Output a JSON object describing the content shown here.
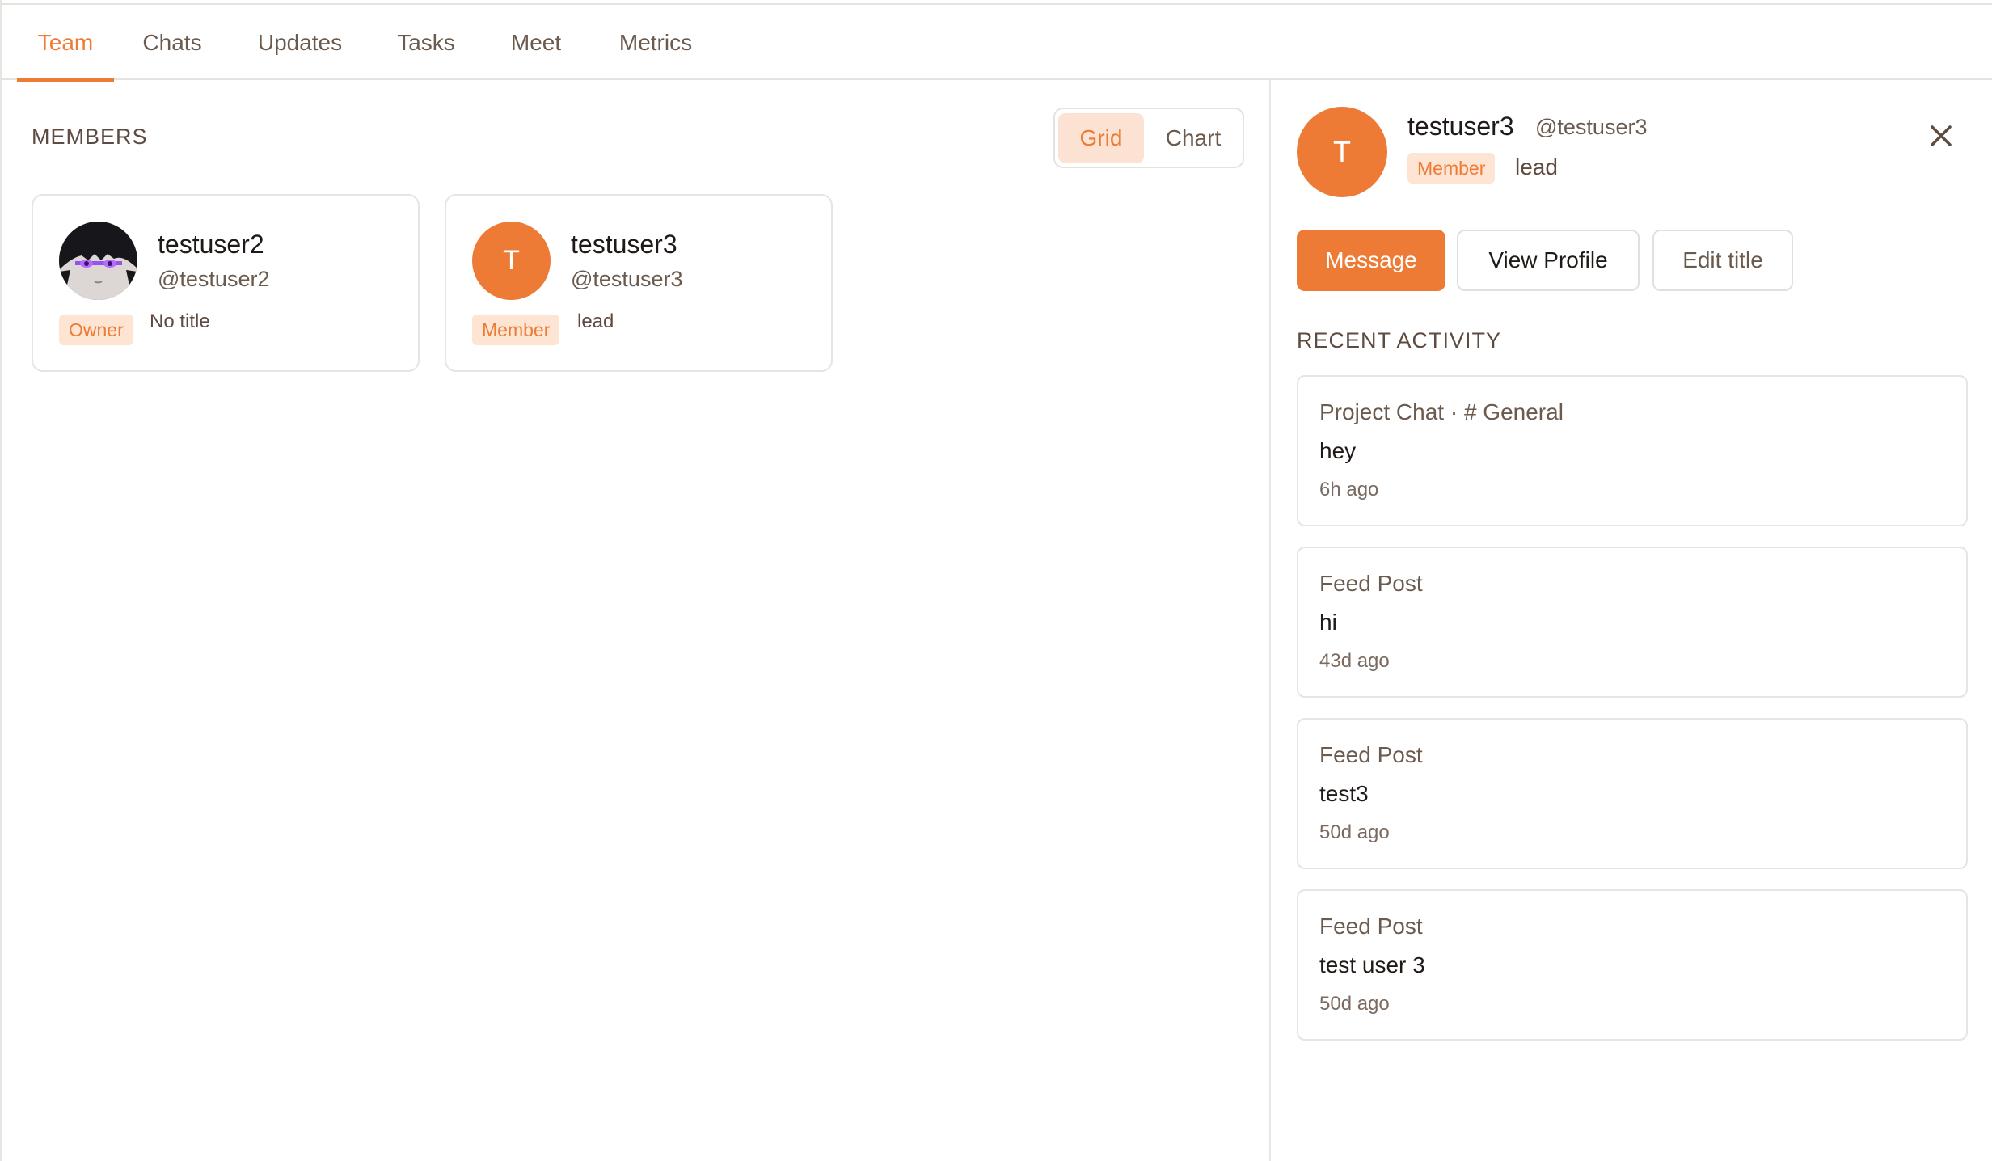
{
  "tabs": [
    "Team",
    "Chats",
    "Updates",
    "Tasks",
    "Meet",
    "Metrics"
  ],
  "active_tab": "Team",
  "members": {
    "heading": "MEMBERS",
    "view_toggle": {
      "grid": "Grid",
      "chart": "Chart",
      "selected": "Grid"
    },
    "cards": [
      {
        "name": "testuser2",
        "handle": "@testuser2",
        "role": "Owner",
        "title": "No title",
        "avatar": "photo"
      },
      {
        "name": "testuser3",
        "handle": "@testuser3",
        "role": "Member",
        "title": "lead",
        "avatar_letter": "T"
      }
    ]
  },
  "profile": {
    "avatar_letter": "T",
    "name": "testuser3",
    "handle": "@testuser3",
    "role": "Member",
    "title": "lead",
    "close_icon": "close-icon",
    "actions": {
      "message": "Message",
      "view_profile": "View Profile",
      "edit_title": "Edit title"
    },
    "recent_heading": "RECENT ACTIVITY",
    "activity": [
      {
        "source": "Project Chat · # General",
        "text": "hey",
        "time": "6h ago"
      },
      {
        "source": "Feed Post",
        "text": "hi",
        "time": "43d ago"
      },
      {
        "source": "Feed Post",
        "text": "test3",
        "time": "50d ago"
      },
      {
        "source": "Feed Post",
        "text": "test user 3",
        "time": "50d ago"
      }
    ]
  },
  "colors": {
    "accent": "#ee7b35",
    "badge_bg": "#fde4d3",
    "border": "#e8e4e0",
    "muted_text": "#6b5a4e"
  }
}
